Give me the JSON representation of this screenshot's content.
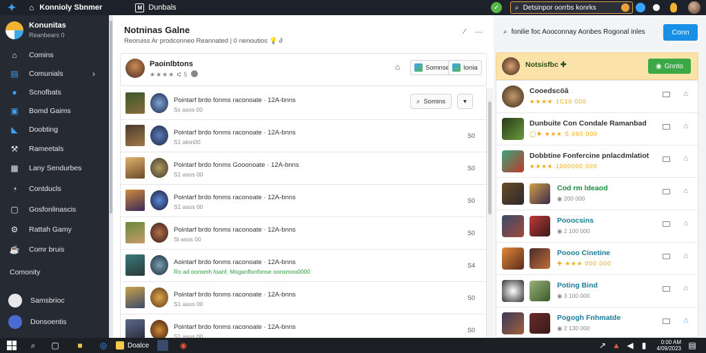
{
  "topbar": {
    "title": "Konnioly Sbnmer",
    "sub_title": "Dunbals",
    "search_text": "Detsinpor oorrbs konrks",
    "colors": {
      "bg": "#1d2129",
      "accent": "#3aa3ff"
    }
  },
  "sidebar": {
    "brand_title": "Konunitas",
    "brand_sub": "Reanbears  0",
    "items": [
      {
        "label": "Comins",
        "icon": "home-icon"
      },
      {
        "label": "Comunials",
        "icon": "chart-icon"
      },
      {
        "label": "Scnofbats",
        "icon": "circle-icon"
      },
      {
        "label": "Bomd Gaims",
        "icon": "gamepad-icon"
      },
      {
        "label": "Doobting",
        "icon": "bookmark-icon"
      },
      {
        "label": "Rameetals",
        "icon": "tools-icon"
      },
      {
        "label": "Lany Sendurbes",
        "icon": "grid-icon"
      },
      {
        "label": "Contducls",
        "icon": "chat-icon"
      },
      {
        "label": "Gosfonlinascis",
        "icon": "gallery-icon"
      },
      {
        "label": "Rattah Gamy",
        "icon": "gear-icon"
      },
      {
        "label": "Comr bruis",
        "icon": "cup-icon"
      }
    ],
    "section_label": "Comonity",
    "users": [
      {
        "label": "Samsbrioc"
      },
      {
        "label": "Donsoentis"
      }
    ]
  },
  "main": {
    "title": "Notninas Galne",
    "subtitle": "Reoruiss Ar prodconneo Reannated | 0 nenoutios 💡 ∂",
    "game": {
      "name": "Paoinlbtons",
      "meta": "★★★★ ⑆ 5",
      "btn1": "Somnse",
      "btn2": "Ionia"
    },
    "filter_label": "Somins",
    "rows": [
      {
        "title": "Pointarf brdo fonms raconoate · 12A-bnns",
        "sub": "Ss asos 00",
        "num": "",
        "green": false
      },
      {
        "title": "Pointarf brdo fonms raconoate · 12A-bnns",
        "sub": "S1 aton00",
        "num": "S0",
        "green": false
      },
      {
        "title": "Pointarf brdo fonms Gooonoate · 12A-bnns",
        "sub": "S1 asos 00",
        "num": "S0",
        "green": false
      },
      {
        "title": "Pointarf brdo fonms raconoate · 12A-bnns",
        "sub": "S1 asos 00",
        "num": "S0",
        "green": false
      },
      {
        "title": "Pointarf brdo fonms raconoate · 12A-bnns",
        "sub": "Sl asos 00",
        "num": "S0",
        "green": false
      },
      {
        "title": "Aointarf brdo fonms raconoate · 12A-bnns",
        "sub": "Ro ad oonsmh foanf. Moganflonfonse oonsmoo0000",
        "num": "S4",
        "green": true
      },
      {
        "title": "Pointarf brdo fonms raconoate · 12A-bnns",
        "sub": "S1 asos 00",
        "num": "S0",
        "green": false
      },
      {
        "title": "Pointarf brdo fonms raconoate · 12A-bnns",
        "sub": "S1 asos 00",
        "num": "S0",
        "green": false
      }
    ]
  },
  "right": {
    "search_text": "fonilie foc Aooconnay Aonbes Rogonal inles",
    "cta": "Conn",
    "featured": {
      "name": "Notsisfbc ✚",
      "button": "Gnnto"
    },
    "items": [
      {
        "name": "Cooedscöâ",
        "sub": "★★★★  1C10 000",
        "style": "",
        "has_second": false
      },
      {
        "name": "Dunbuite Con Condale Ramanbad",
        "sub": "◯✚ ★★★  S 060 000",
        "style": "",
        "has_second": true
      },
      {
        "name": "Dobbtine Fonfercine pnlacdmlatiot",
        "sub": "★★★★ 1000000  000",
        "style": "",
        "has_second": true
      },
      {
        "name": "Cod rm ldeaod",
        "sub": "◉ 200 000",
        "style": "green",
        "has_second": true
      },
      {
        "name": "Pooocsins",
        "sub": "◉ 2 100 000",
        "style": "teal",
        "has_second": true
      },
      {
        "name": "Poooo Cinetine",
        "sub": "✚ ★★★  000 000",
        "style": "teal",
        "has_second": true
      },
      {
        "name": "Poting Bind",
        "sub": "◉ 3 100 000",
        "style": "teal",
        "has_second": true
      },
      {
        "name": "Pogogh Fnhmatde",
        "sub": "◉ 2 130 000",
        "style": "teal",
        "has_second": true
      }
    ]
  },
  "taskbar": {
    "app_label": "Doalce",
    "time": "0:00 AM",
    "date": "4/09/2023"
  }
}
